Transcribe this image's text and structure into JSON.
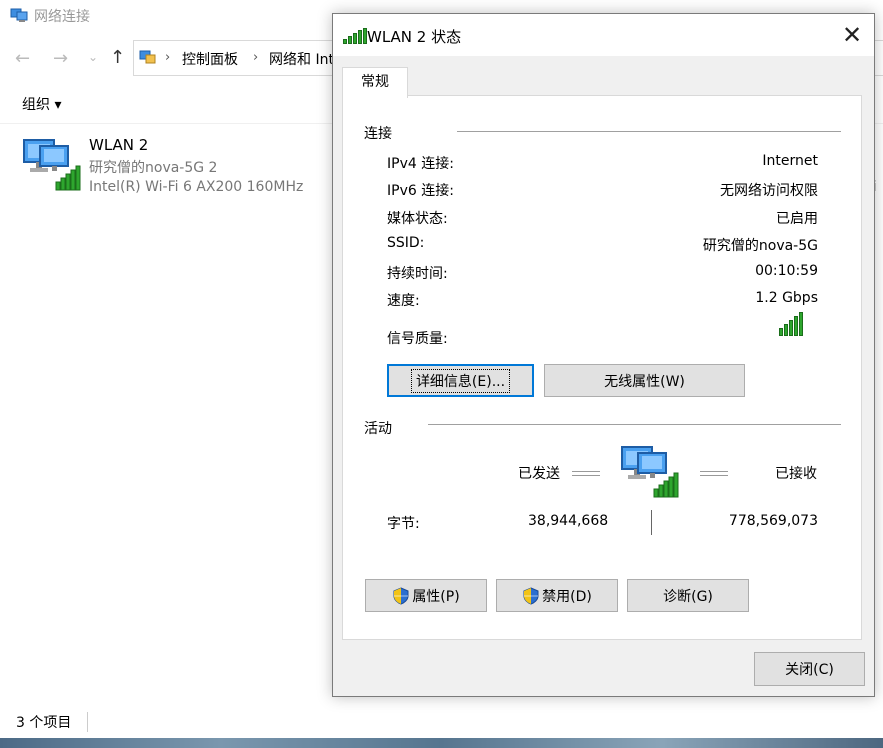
{
  "explorer": {
    "title": "网络连接",
    "breadcrumb": [
      "控制面板",
      "网络和 Int"
    ],
    "organize_label": "组织 ▾",
    "connection": {
      "name": "WLAN 2",
      "ssid": "研究僧的nova-5G 2",
      "adapter": "Intel(R) Wi-Fi 6 AX200 160MHz"
    },
    "right_fragment": "i",
    "status_count": "3 个项目"
  },
  "dialog": {
    "title": "WLAN 2 状态",
    "close_glyph": "✕",
    "tab_general": "常规",
    "connection_group": "连接",
    "rows": [
      {
        "label": "IPv4 连接:",
        "value": "Internet"
      },
      {
        "label": "IPv6 连接:",
        "value": "无网络访问权限"
      },
      {
        "label": "媒体状态:",
        "value": "已启用"
      },
      {
        "label": "SSID:",
        "value": "研究僧的nova-5G"
      },
      {
        "label": "持续时间:",
        "value": "00:10:59"
      },
      {
        "label": "速度:",
        "value": "1.2 Gbps"
      }
    ],
    "signal_label": "信号质量:",
    "signal_bars": 5,
    "details_button": "详细信息(E)...",
    "wireless_props_button": "无线属性(W)",
    "activity_group": "活动",
    "sent_label": "已发送",
    "received_label": "已接收",
    "bytes_label": "字节:",
    "bytes_sent": "38,944,668",
    "bytes_received": "778,569,073",
    "properties_button": "属性(P)",
    "disable_button": "禁用(D)",
    "diagnose_button": "诊断(G)",
    "close_button": "关闭(C)"
  },
  "colors": {
    "signal_green": "#2ea62e",
    "focus_blue": "#0078d7",
    "dialog_bg": "#f0f0f0"
  }
}
